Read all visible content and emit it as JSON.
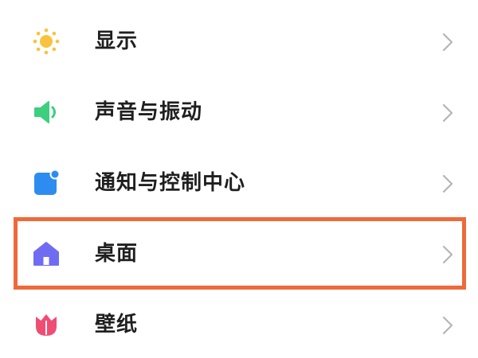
{
  "settings": {
    "items": [
      {
        "label": "显示",
        "icon": "sun-icon",
        "icon_color": "#f9c23c"
      },
      {
        "label": "声音与振动",
        "icon": "speaker-icon",
        "icon_color": "#3ccf7e"
      },
      {
        "label": "通知与控制中心",
        "icon": "notification-icon",
        "icon_color": "#2d8cf0"
      },
      {
        "label": "桌面",
        "icon": "home-icon",
        "icon_color": "#6f6cf2"
      },
      {
        "label": "壁纸",
        "icon": "tulip-icon",
        "icon_color": "#f04d74"
      }
    ],
    "highlighted_item": "桌面",
    "highlight_color": "#ee6a3a",
    "chevron_color": "#b5b5b5"
  }
}
